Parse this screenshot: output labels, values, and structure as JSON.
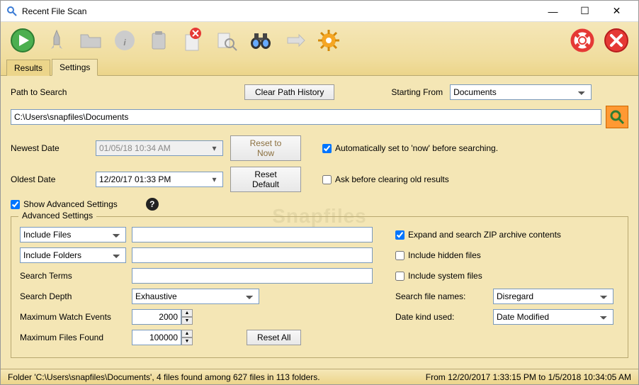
{
  "window": {
    "title": "Recent File Scan"
  },
  "tabs": {
    "results": "Results",
    "settings": "Settings"
  },
  "search": {
    "path_label": "Path to Search",
    "clear_history": "Clear Path History",
    "starting_from_label": "Starting From",
    "starting_from_value": "Documents",
    "path_value": "C:\\Users\\snapfiles\\Documents"
  },
  "dates": {
    "newest_label": "Newest Date",
    "newest_value": "01/05/18 10:34 AM",
    "reset_now": "Reset to Now",
    "oldest_label": "Oldest Date",
    "oldest_value": "12/20/17 01:33 PM",
    "reset_default": "Reset Default",
    "auto_now": "Automatically set to 'now' before searching.",
    "ask_clear": "Ask before clearing old results"
  },
  "adv_toggle": "Show Advanced Settings",
  "adv": {
    "legend": "Advanced Settings",
    "include_files": "Include Files",
    "include_folders": "Include Folders",
    "search_terms_label": "Search Terms",
    "search_depth_label": "Search Depth",
    "search_depth_value": "Exhaustive",
    "max_watch_label": "Maximum Watch Events",
    "max_watch_value": "2000",
    "max_files_label": "Maximum Files Found",
    "max_files_value": "100000",
    "reset_all": "Reset All",
    "expand_zip": "Expand and search ZIP archive contents",
    "hidden": "Include hidden files",
    "system": "Include system files",
    "search_names_label": "Search file names:",
    "search_names_value": "Disregard",
    "date_kind_label": "Date kind used:",
    "date_kind_value": "Date Modified"
  },
  "status": {
    "left": "Folder 'C:\\Users\\snapfiles\\Documents', 4 files found among 627 files in 113 folders.",
    "right": "From 12/20/2017 1:33:15 PM to 1/5/2018 10:34:05 AM"
  }
}
